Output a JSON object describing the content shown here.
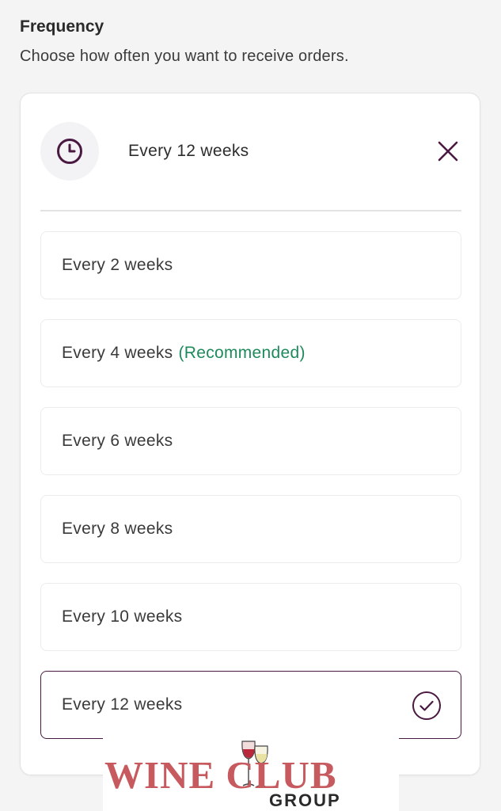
{
  "frequency": {
    "title": "Frequency",
    "subtitle": "Choose how often you want to receive orders."
  },
  "selected": {
    "icon": "clock-icon",
    "label": "Every 12 weeks",
    "close_icon": "close-icon"
  },
  "options": [
    {
      "label": "Every 2 weeks",
      "badge": ""
    },
    {
      "label": "Every 4 weeks",
      "badge": "(Recommended)"
    },
    {
      "label": "Every 6 weeks",
      "badge": ""
    },
    {
      "label": "Every 8 weeks",
      "badge": ""
    },
    {
      "label": "Every 10 weeks",
      "badge": ""
    },
    {
      "label": "Every 12 weeks",
      "badge": "",
      "selected": true
    }
  ],
  "watermark": {
    "brand": "WINE CLUB",
    "sub": "GROUP"
  },
  "colors": {
    "accent": "#4a1942",
    "recommended": "#1e8a5c",
    "watermark_red": "#c65a5f"
  }
}
